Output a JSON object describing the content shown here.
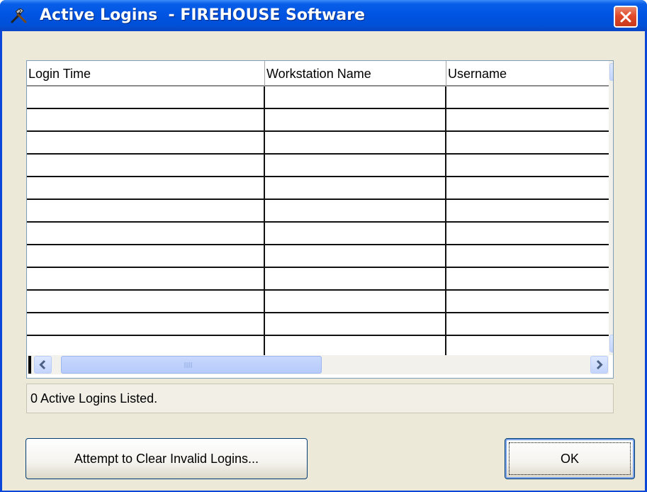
{
  "window": {
    "title": "Active Logins  - FIREHOUSE Software",
    "icon": "tools-icon",
    "close_icon": "close-icon"
  },
  "grid": {
    "columns": [
      "Login Time",
      "Workstation Name",
      "Username"
    ],
    "rows": [
      [
        "",
        "",
        ""
      ],
      [
        "",
        "",
        ""
      ],
      [
        "",
        "",
        ""
      ],
      [
        "",
        "",
        ""
      ],
      [
        "",
        "",
        ""
      ],
      [
        "",
        "",
        ""
      ],
      [
        "",
        "",
        ""
      ],
      [
        "",
        "",
        ""
      ],
      [
        "",
        "",
        ""
      ],
      [
        "",
        "",
        ""
      ],
      [
        "",
        "",
        ""
      ],
      [
        "",
        "",
        ""
      ]
    ],
    "scrollbar_icons": [
      "chevron-up-icon",
      "chevron-down-icon",
      "chevron-left-icon",
      "chevron-right-icon"
    ]
  },
  "status": {
    "text": "0 Active Logins Listed."
  },
  "buttons": {
    "clear_label": "Attempt to Clear Invalid Logins...",
    "ok_label": "OK"
  },
  "colors": {
    "titlebar": "#0054e3",
    "client": "#ece9d8",
    "close": "#e14a2a"
  }
}
